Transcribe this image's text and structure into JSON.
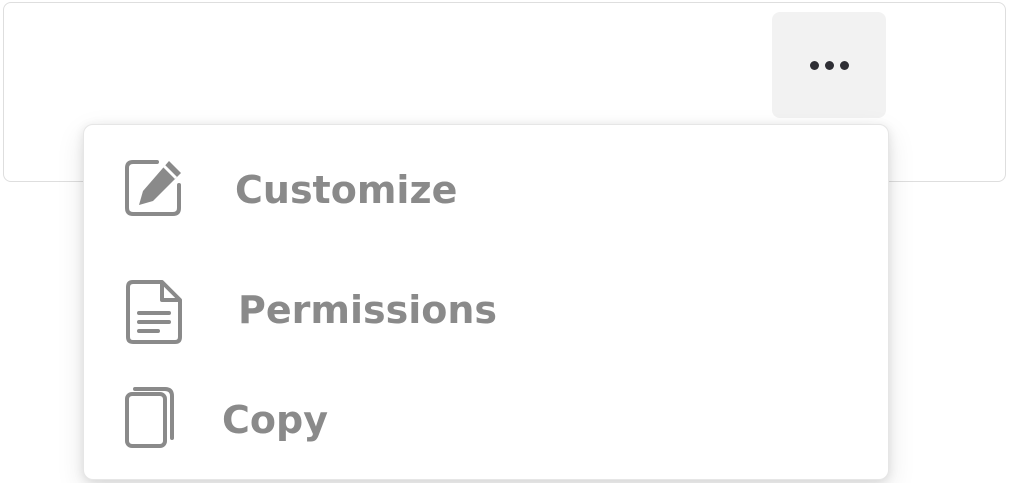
{
  "more_button": {
    "icon": "more-horizontal-icon"
  },
  "menu": {
    "items": [
      {
        "label": "Customize",
        "icon": "edit-icon"
      },
      {
        "label": "Permissions",
        "icon": "document-icon"
      },
      {
        "label": "Copy",
        "icon": "copy-icon"
      }
    ]
  },
  "colors": {
    "menu_text": "#8a8a8a",
    "icon_stroke": "#8a8a8a",
    "dots": "#2f2f35",
    "button_bg": "#f2f2f2"
  }
}
